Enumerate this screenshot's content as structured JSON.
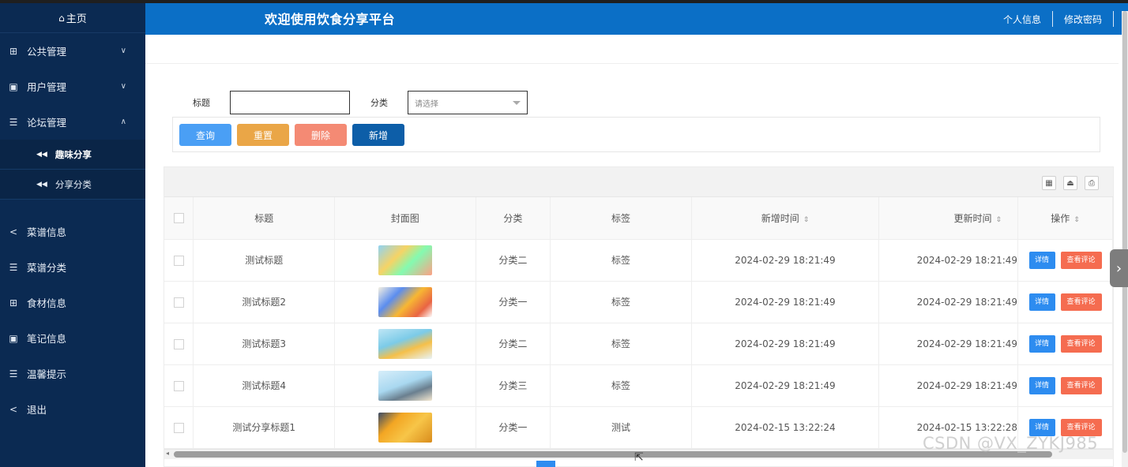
{
  "sidebar": {
    "home": "主页",
    "items": [
      {
        "label": "公共管理",
        "icon": "grid-icon",
        "arrow": "⌄"
      },
      {
        "label": "用户管理",
        "icon": "book-icon",
        "arrow": "⌄"
      },
      {
        "label": "论坛管理",
        "icon": "list-icon",
        "arrow": "^"
      }
    ],
    "sub_items": [
      {
        "label": "趣味分享"
      },
      {
        "label": "分享分类"
      }
    ],
    "items2": [
      {
        "label": "菜谱信息",
        "icon": "share-icon"
      },
      {
        "label": "菜谱分类",
        "icon": "list-icon"
      },
      {
        "label": "食材信息",
        "icon": "grid-icon"
      },
      {
        "label": "笔记信息",
        "icon": "book-icon"
      },
      {
        "label": "温馨提示",
        "icon": "list-icon"
      },
      {
        "label": "退出",
        "icon": "share-icon"
      }
    ]
  },
  "header": {
    "title": "欢迎使用饮食分享平台",
    "profile": "个人信息",
    "change_password": "修改密码"
  },
  "search": {
    "title_label": "标题",
    "category_label": "分类",
    "category_placeholder": "请选择"
  },
  "buttons": {
    "query": "查询",
    "reset": "重置",
    "delete": "删除",
    "add": "新增"
  },
  "table": {
    "headers": {
      "title": "标题",
      "cover": "封面图",
      "category": "分类",
      "tag": "标签",
      "created": "新增时间",
      "updated": "更新时间",
      "action": "操作"
    },
    "rows": [
      {
        "title": "测试标题",
        "category": "分类二",
        "tag": "标签",
        "created": "2024-02-29 18:21:49",
        "updated": "2024-02-29 18:21:49"
      },
      {
        "title": "测试标题2",
        "category": "分类一",
        "tag": "标签",
        "created": "2024-02-29 18:21:49",
        "updated": "2024-02-29 18:21:49"
      },
      {
        "title": "测试标题3",
        "category": "分类二",
        "tag": "标签",
        "created": "2024-02-29 18:21:49",
        "updated": "2024-02-29 18:21:49"
      },
      {
        "title": "测试标题4",
        "category": "分类三",
        "tag": "标签",
        "created": "2024-02-29 18:21:49",
        "updated": "2024-02-29 18:21:49"
      },
      {
        "title": "测试分享标题1",
        "category": "分类一",
        "tag": "测试",
        "created": "2024-02-15 13:22:24",
        "updated": "2024-02-15 13:22:28"
      }
    ],
    "detail_label": "详情",
    "comment_label": "查看评论"
  },
  "watermark": "CSDN @VX_ZYKJ985",
  "colors": {
    "sidebar": "#0b2a52",
    "header": "#0b6fc6",
    "query_btn": "#4a9ff5",
    "reset_btn": "#eaa647",
    "delete_btn": "#f48a74",
    "add_btn": "#0d5ea8",
    "detail_btn": "#2d8cf0",
    "comment_btn": "#f56c50"
  }
}
